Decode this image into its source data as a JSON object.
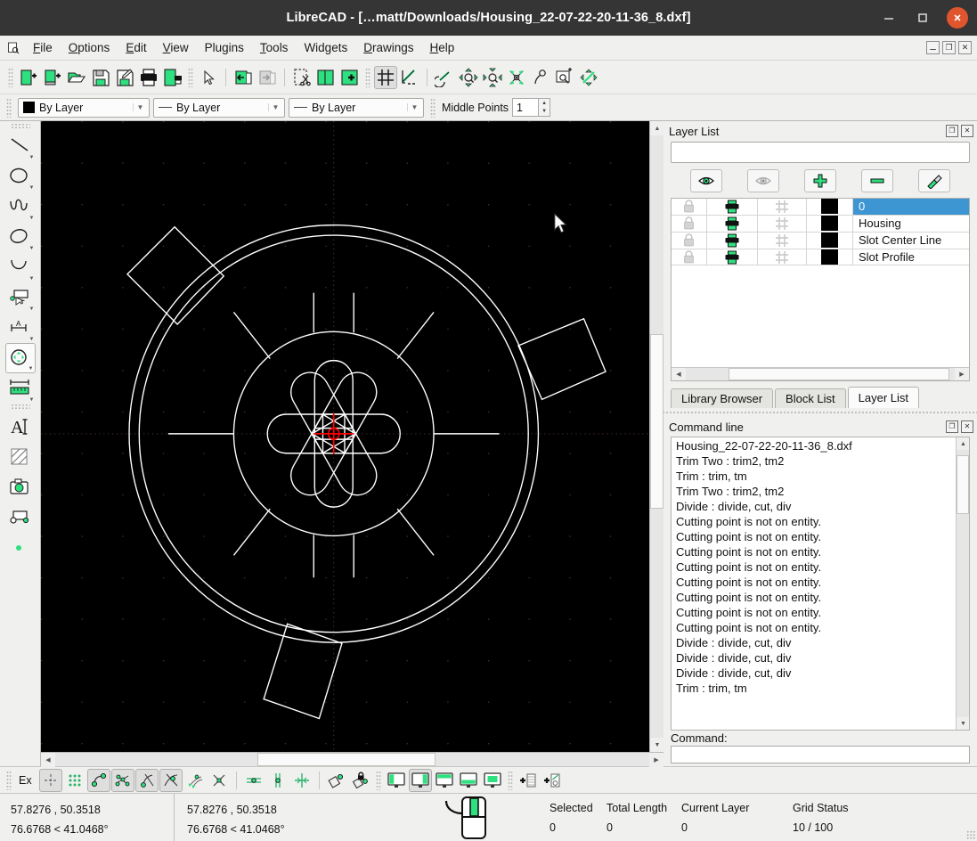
{
  "window": {
    "title": "LibreCAD - […matt/Downloads/Housing_22-07-22-20-11-36_8.dxf]",
    "minimize_label": "—",
    "maximize_label": "□",
    "close_label": "✕"
  },
  "menubar": {
    "items": [
      {
        "label": "File",
        "mnemonic": "F"
      },
      {
        "label": "Options",
        "mnemonic": "O"
      },
      {
        "label": "Edit",
        "mnemonic": "E"
      },
      {
        "label": "View",
        "mnemonic": "V"
      },
      {
        "label": "Plugins",
        "mnemonic": "g"
      },
      {
        "label": "Tools",
        "mnemonic": "T"
      },
      {
        "label": "Widgets",
        "mnemonic": "W"
      },
      {
        "label": "Drawings",
        "mnemonic": "D"
      },
      {
        "label": "Help",
        "mnemonic": "H"
      }
    ],
    "mdi_buttons": [
      "minimize-doc",
      "restore-doc",
      "close-doc"
    ]
  },
  "toolbar": {
    "buttons": [
      {
        "name": "new-file-icon",
        "tip": "New"
      },
      {
        "name": "new-from-template-icon",
        "tip": "New from template"
      },
      {
        "name": "open-file-icon",
        "tip": "Open"
      },
      {
        "name": "save-icon",
        "tip": "Save"
      },
      {
        "name": "save-as-icon",
        "tip": "Save as"
      },
      {
        "name": "print-icon",
        "tip": "Print"
      },
      {
        "name": "print-preview-icon",
        "tip": "Print preview"
      },
      {
        "name": "select-pointer-icon",
        "tip": "Select"
      },
      {
        "name": "undo-icon",
        "tip": "Undo"
      },
      {
        "name": "redo-icon",
        "tip": "Redo"
      },
      {
        "name": "cut-icon",
        "tip": "Cut"
      },
      {
        "name": "copy-icon",
        "tip": "Copy"
      },
      {
        "name": "paste-icon",
        "tip": "Paste"
      },
      {
        "name": "grid-toggle-icon",
        "tip": "Grid",
        "active": true
      },
      {
        "name": "draw-order-icon",
        "tip": "Draw order"
      },
      {
        "name": "zoom-previous-icon",
        "tip": "Zoom previous"
      },
      {
        "name": "zoom-in-icon",
        "tip": "Zoom in"
      },
      {
        "name": "zoom-out-icon",
        "tip": "Zoom out"
      },
      {
        "name": "zoom-auto-icon",
        "tip": "Zoom auto"
      },
      {
        "name": "zoom-pan-icon",
        "tip": "Pan"
      },
      {
        "name": "zoom-window-icon",
        "tip": "Zoom window"
      },
      {
        "name": "zoom-redraw-icon",
        "tip": "Redraw"
      }
    ]
  },
  "attributes_bar": {
    "color": {
      "label": "By Layer",
      "swatch": "#000000"
    },
    "linewidth": {
      "label": "By Layer"
    },
    "linetype": {
      "label": "By Layer"
    },
    "middle_points_label": "Middle Points",
    "middle_points_value": "1"
  },
  "left_toolbar": {
    "buttons": [
      {
        "name": "line-tool-icon",
        "tip": "Line"
      },
      {
        "name": "circle-tool-icon",
        "tip": "Circle"
      },
      {
        "name": "spline-tool-icon",
        "tip": "Spline"
      },
      {
        "name": "ellipse-tool-icon",
        "tip": "Ellipse"
      },
      {
        "name": "arc-tool-icon",
        "tip": "Arc"
      },
      {
        "name": "polyline-tool-icon",
        "tip": "Polyline"
      },
      {
        "name": "dimension-tool-icon",
        "tip": "Dimension"
      },
      {
        "name": "modify-tool-icon",
        "tip": "Modify",
        "active": true
      },
      {
        "name": "info-measure-tool-icon",
        "tip": "Info"
      },
      {
        "name": "text-tool-icon",
        "tip": "Text"
      },
      {
        "name": "hatch-tool-icon",
        "tip": "Hatch"
      },
      {
        "name": "image-tool-icon",
        "tip": "Image"
      },
      {
        "name": "block-tool-icon",
        "tip": "Block"
      },
      {
        "name": "point-tool-icon",
        "tip": "Point"
      }
    ]
  },
  "layer_panel": {
    "title": "Layer List",
    "filter_value": "",
    "filter_placeholder": "",
    "buttons": [
      {
        "name": "show-all-layers-icon",
        "tip": "Show all"
      },
      {
        "name": "hide-all-layers-icon",
        "tip": "Hide all"
      },
      {
        "name": "add-layer-icon",
        "tip": "Add layer"
      },
      {
        "name": "remove-layer-icon",
        "tip": "Remove layer"
      },
      {
        "name": "edit-layer-icon",
        "tip": "Edit layer"
      }
    ],
    "columns": [
      "lock",
      "print",
      "construction",
      "color",
      "name"
    ],
    "rows": [
      {
        "name": "0",
        "color": "#000000",
        "selected": true
      },
      {
        "name": "Housing",
        "color": "#000000",
        "selected": false
      },
      {
        "name": "Slot Center Line",
        "color": "#000000",
        "selected": false
      },
      {
        "name": "Slot Profile",
        "color": "#000000",
        "selected": false
      }
    ],
    "tabs": [
      {
        "label": "Library Browser",
        "active": false
      },
      {
        "label": "Block List",
        "active": false
      },
      {
        "label": "Layer List",
        "active": true
      }
    ]
  },
  "command_panel": {
    "title": "Command line",
    "lines": [
      "Housing_22-07-22-20-11-36_8.dxf",
      "Trim Two : trim2, tm2",
      "Trim : trim, tm",
      "Trim Two : trim2, tm2",
      "Divide : divide, cut, div",
      "Cutting point is not on entity.",
      "Cutting point is not on entity.",
      "Cutting point is not on entity.",
      "Cutting point is not on entity.",
      "Cutting point is not on entity.",
      "Cutting point is not on entity.",
      "Cutting point is not on entity.",
      "Cutting point is not on entity.",
      "Divide : divide, cut, div",
      "Divide : divide, cut, div",
      "Divide : divide, cut, div",
      "Trim : trim, tm"
    ],
    "prompt_label": "Command:",
    "input_value": ""
  },
  "snap_toolbar": {
    "ex_label": "Ex",
    "buttons": [
      {
        "name": "snap-free-icon",
        "active": true
      },
      {
        "name": "snap-grid-icon",
        "active": false
      },
      {
        "name": "snap-endpoint-icon",
        "active": true
      },
      {
        "name": "snap-intersection-icon",
        "active": true
      },
      {
        "name": "snap-middle-icon",
        "active": true
      },
      {
        "name": "snap-center-icon",
        "active": true
      },
      {
        "name": "snap-distance-icon",
        "active": false
      },
      {
        "name": "snap-nearest-icon",
        "active": false
      },
      {
        "name": "restrict-horizontal-icon",
        "active": false
      },
      {
        "name": "restrict-vertical-icon",
        "active": false
      },
      {
        "name": "restrict-orthogonal-icon",
        "active": false
      },
      {
        "name": "relative-zero-icon",
        "active": false
      },
      {
        "name": "lock-relative-zero-icon",
        "active": false
      },
      {
        "name": "fullscreen-left-icon",
        "active": false
      },
      {
        "name": "fullscreen-center-icon",
        "active": true
      },
      {
        "name": "fullscreen-top-icon",
        "active": false
      },
      {
        "name": "fullscreen-bottom-icon",
        "active": false
      },
      {
        "name": "fullscreen-fill-icon",
        "active": false
      },
      {
        "name": "add-layer-quick-icon",
        "active": false
      },
      {
        "name": "add-entity-quick-icon",
        "active": false
      }
    ]
  },
  "statusbar": {
    "abs_coord": "57.8276 , 50.3518",
    "abs_polar": "76.6768 < 41.0468°",
    "rel_coord": "57.8276 , 50.3518",
    "rel_polar": "76.6768 < 41.0468°",
    "selected_label": "Selected",
    "selected_value": "0",
    "total_length_label": "Total Length",
    "total_length_value": "0",
    "current_layer_label": "Current Layer",
    "current_layer_value": "0",
    "grid_status_label": "Grid Status",
    "grid_status_value": "10 / 100"
  },
  "drawing": {
    "background": "#000000",
    "entity_color": "#ffffff",
    "crosshair_color": "#ff0000",
    "grid_dot_color": "#3a3a3a",
    "axis_color": "#4a3030",
    "description": "Mechanical housing part: outer ring with 6 radial rounded slots, 3 outer tabs, center mark"
  }
}
